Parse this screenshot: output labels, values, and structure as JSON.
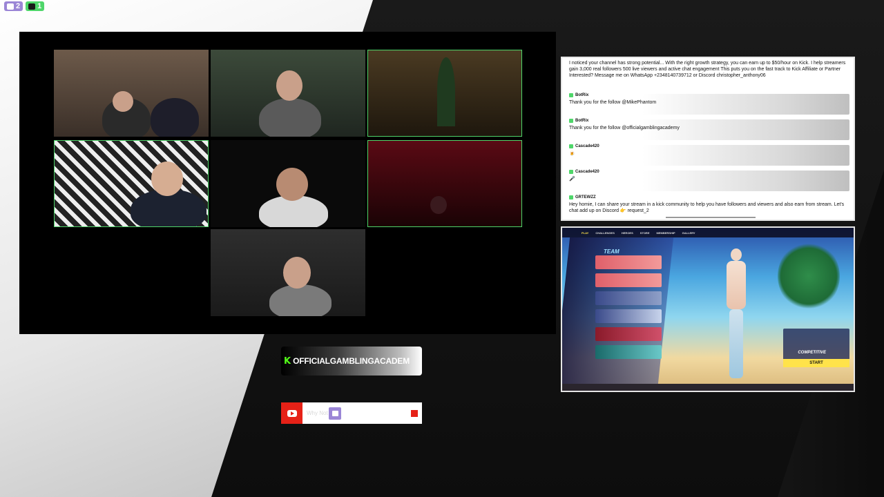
{
  "counters": {
    "twitch_count": "2",
    "kick_count": "1"
  },
  "video_grid": {
    "tiles": [
      {
        "id": "cam-1",
        "active": false
      },
      {
        "id": "cam-2",
        "active": false
      },
      {
        "id": "cam-3",
        "active": true
      },
      {
        "id": "cam-4",
        "active": true
      },
      {
        "id": "cam-5",
        "active": false
      },
      {
        "id": "cam-6",
        "active": true
      },
      {
        "id": "cam-7",
        "active": false
      }
    ]
  },
  "chat": {
    "top_message": "I noticed your channel has strong potential... With the right growth strategy, you can earn up to $50/hour on Kick. I help streamers gain 3,000 real followers 500 live viewers and active chat engagement This puts you on the fast track to Kick Affiliate or Partner Interested? Message me on WhatsApp +2348140739712 or Discord christopher_anthony06",
    "messages": [
      {
        "user": "BotRix",
        "text": "Thank you for the follow @MikePhantom"
      },
      {
        "user": "BotRix",
        "text": "Thank you for the follow @officialgamblingacademy"
      },
      {
        "user": "Cascade420",
        "text": "🍺"
      },
      {
        "user": "Cascade420",
        "text": "🎤"
      },
      {
        "user": "GRTEWZZ",
        "text": "Hey homie, I can share your stream in a kick community to help you have followers and viewers and also earn from stream. Let's chat add up on Discord 👉 request_2"
      }
    ]
  },
  "game": {
    "nav": [
      "PLAY",
      "CHALLENGES",
      "HEROES",
      "STORE",
      "MEMBERSHIP",
      "GALLERY"
    ],
    "active_nav": "PLAY",
    "team_title": "TEAM",
    "mode_label": "COMPETITIVE",
    "start_label": "START"
  },
  "channel": {
    "name": "OFFICIALGAMBLINGACADEM",
    "logo_glyph": "K"
  },
  "socials": {
    "placeholder_text": "Why Not"
  },
  "colors": {
    "kick_green": "#53fc18",
    "twitch_purple": "#9b86d6",
    "youtube_red": "#e62117",
    "active_border": "#4fd66a"
  }
}
